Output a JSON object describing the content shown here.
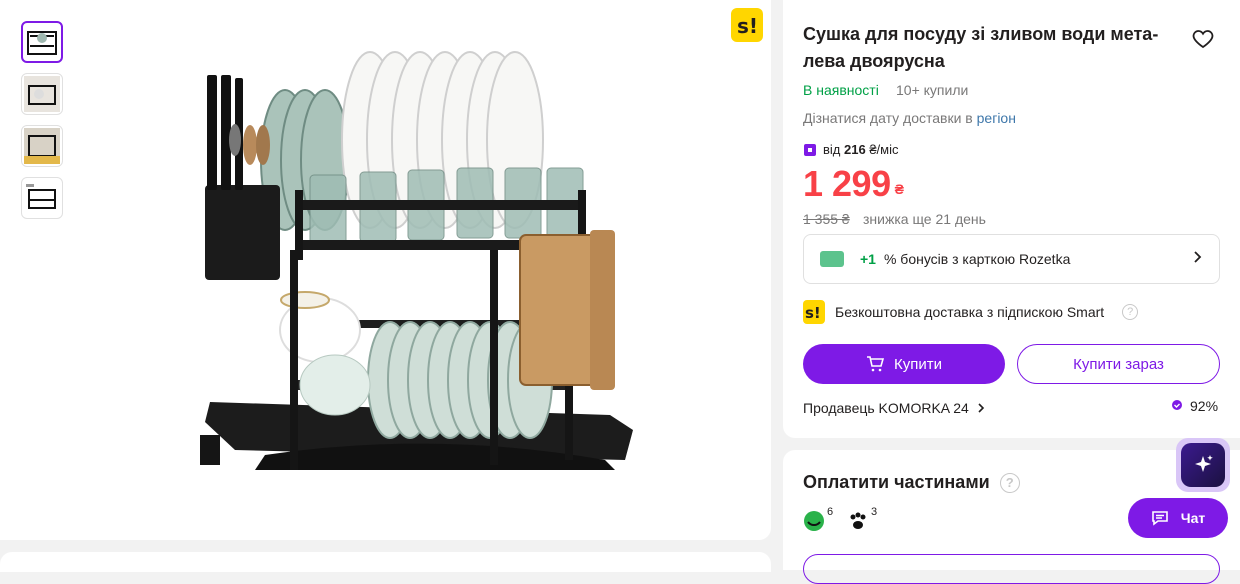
{
  "product": {
    "title": "Сушка для посуду зі зливом води мета-лева двоярусна",
    "availability": "В наявності",
    "bought": "10+ купили",
    "delivery_text": "Дізнатися дату доставки в ",
    "delivery_link": "регіон",
    "credit_prefix": "від ",
    "credit_amount": "216",
    "credit_suffix": " ₴/міс",
    "price": "1 299",
    "currency": "₴",
    "old_price": "1 355 ₴",
    "discount_text": "знижка ще 21 день",
    "bonus_plus": "+1",
    "bonus_text": "% бонусів з карткою Rozetka",
    "smart_text": "Безкоштовна доставка з підпискою Smart",
    "help": "?",
    "buy_label": "Купити",
    "buy_now_label": "Купити зараз",
    "seller_label": "Продавець KOMORKA 24",
    "rating": "92%"
  },
  "payment": {
    "title": "Оплатити частинами",
    "help": "?",
    "banks": [
      {
        "count": "6"
      },
      {
        "count": "3"
      }
    ]
  },
  "chat": {
    "label": "Чат"
  },
  "colors": {
    "accent": "#7e1ae6",
    "price": "#f84147",
    "available": "#00a046",
    "smart": "#ffd600"
  },
  "icons": [
    "heart-icon",
    "cart-icon",
    "chevron-right-icon",
    "sparkle-icon",
    "chat-icon",
    "help-icon",
    "smart-logo-icon",
    "card-icon",
    "badge-icon"
  ],
  "thumbnails": [
    "thumb-1",
    "thumb-2",
    "thumb-3",
    "thumb-4"
  ]
}
